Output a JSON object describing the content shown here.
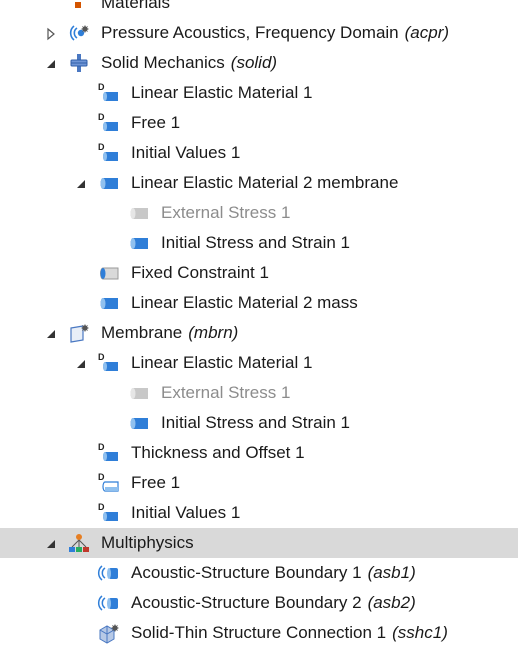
{
  "tree": {
    "rows": [
      {
        "id": "materials",
        "label": "Materials",
        "tag": "",
        "icon": "materials-icon",
        "level": 1,
        "expander": "none",
        "disabled": false,
        "selected": false
      },
      {
        "id": "acpr",
        "label": "Pressure Acoustics, Frequency Domain",
        "tag": "(acpr)",
        "icon": "pressure-acoustics-icon",
        "level": 1,
        "expander": "collapsed",
        "disabled": false,
        "selected": false
      },
      {
        "id": "solid",
        "label": "Solid Mechanics",
        "tag": "(solid)",
        "icon": "solid-mechanics-icon",
        "level": 1,
        "expander": "expanded",
        "disabled": false,
        "selected": false
      },
      {
        "id": "lem1",
        "label": "Linear Elastic Material 1",
        "tag": "",
        "icon": "domain-default-icon",
        "level": 2,
        "expander": "none",
        "disabled": false,
        "selected": false
      },
      {
        "id": "free1",
        "label": "Free 1",
        "tag": "",
        "icon": "domain-default-icon",
        "level": 2,
        "expander": "none",
        "disabled": false,
        "selected": false
      },
      {
        "id": "iv1",
        "label": "Initial Values 1",
        "tag": "",
        "icon": "domain-default-icon",
        "level": 2,
        "expander": "none",
        "disabled": false,
        "selected": false
      },
      {
        "id": "lem2m",
        "label": "Linear Elastic Material 2 membrane",
        "tag": "",
        "icon": "domain-node-icon",
        "level": 2,
        "expander": "expanded",
        "disabled": false,
        "selected": false
      },
      {
        "id": "es1",
        "label": "External Stress 1",
        "tag": "",
        "icon": "domain-node-disabled-icon",
        "level": 3,
        "expander": "none",
        "disabled": true,
        "selected": false
      },
      {
        "id": "iss1",
        "label": "Initial Stress and Strain 1",
        "tag": "",
        "icon": "domain-node-icon",
        "level": 3,
        "expander": "none",
        "disabled": false,
        "selected": false
      },
      {
        "id": "fc1",
        "label": "Fixed Constraint 1",
        "tag": "",
        "icon": "fixed-constraint-icon",
        "level": 2,
        "expander": "none",
        "disabled": false,
        "selected": false
      },
      {
        "id": "lem2mass",
        "label": "Linear Elastic Material 2 mass",
        "tag": "",
        "icon": "domain-node-icon",
        "level": 2,
        "expander": "none",
        "disabled": false,
        "selected": false
      },
      {
        "id": "mbrn",
        "label": "Membrane",
        "tag": "(mbrn)",
        "icon": "membrane-icon",
        "level": 1,
        "expander": "expanded",
        "disabled": false,
        "selected": false
      },
      {
        "id": "mlem1",
        "label": "Linear Elastic Material 1",
        "tag": "",
        "icon": "domain-default-icon",
        "level": 2,
        "expander": "expanded",
        "disabled": false,
        "selected": false
      },
      {
        "id": "mes1",
        "label": "External Stress 1",
        "tag": "",
        "icon": "domain-node-disabled-icon",
        "level": 3,
        "expander": "none",
        "disabled": true,
        "selected": false
      },
      {
        "id": "miss1",
        "label": "Initial Stress and Strain 1",
        "tag": "",
        "icon": "domain-node-icon",
        "level": 3,
        "expander": "none",
        "disabled": false,
        "selected": false
      },
      {
        "id": "tao1",
        "label": "Thickness and Offset 1",
        "tag": "",
        "icon": "domain-default-icon",
        "level": 2,
        "expander": "none",
        "disabled": false,
        "selected": false
      },
      {
        "id": "mfree1",
        "label": "Free 1",
        "tag": "",
        "icon": "domain-default-light-icon",
        "level": 2,
        "expander": "none",
        "disabled": false,
        "selected": false
      },
      {
        "id": "miv1",
        "label": "Initial Values 1",
        "tag": "",
        "icon": "domain-default-icon",
        "level": 2,
        "expander": "none",
        "disabled": false,
        "selected": false
      },
      {
        "id": "mph",
        "label": "Multiphysics",
        "tag": "",
        "icon": "multiphysics-icon",
        "level": 1,
        "expander": "expanded",
        "disabled": false,
        "selected": true
      },
      {
        "id": "asb1",
        "label": "Acoustic-Structure Boundary 1",
        "tag": "(asb1)",
        "icon": "acoustic-structure-icon",
        "level": 2,
        "expander": "none",
        "disabled": false,
        "selected": false
      },
      {
        "id": "asb2",
        "label": "Acoustic-Structure Boundary 2",
        "tag": "(asb2)",
        "icon": "acoustic-structure-icon",
        "level": 2,
        "expander": "none",
        "disabled": false,
        "selected": false
      },
      {
        "id": "sshc1",
        "label": "Solid-Thin Structure Connection 1",
        "tag": "(sshc1)",
        "icon": "solid-thin-connection-icon",
        "level": 2,
        "expander": "none",
        "disabled": false,
        "selected": false
      }
    ]
  },
  "colors": {
    "accent_blue": "#2f7ed8",
    "disabled_gray": "#c8c8c8",
    "selected_row": "#d9d9d9",
    "text": "#1a1a1a",
    "disabled_text": "#8c8c8c"
  }
}
